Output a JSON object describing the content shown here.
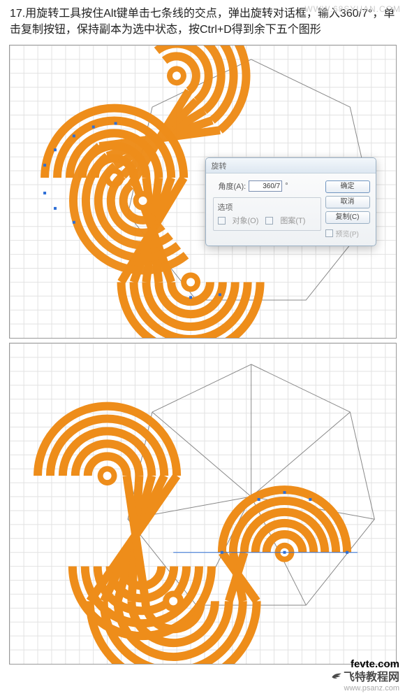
{
  "instruction": {
    "step_label": "17.",
    "text": "用旋转工具按住Alt键单击七条线的交点，弹出旋转对话框，输入360/7°，单击复制按钮，保持副本为选中状态，按Ctrl+D得到余下五个图形"
  },
  "dialog": {
    "title": "旋转",
    "angle_label": "角度(A):",
    "angle_value": "360/7",
    "angle_unit": "°",
    "options_group_label": "选项",
    "opt_objects": "对象(O)",
    "opt_patterns": "图案(T)",
    "btn_ok": "确定",
    "btn_cancel": "取消",
    "btn_copy": "复制(C)",
    "preview_label": "预览(P)"
  },
  "watermarks": {
    "top": "WWW.68SYUAN.COM",
    "fevte": "fevte.com",
    "cn": "飞特教程网",
    "url": "www.psanz.com"
  }
}
